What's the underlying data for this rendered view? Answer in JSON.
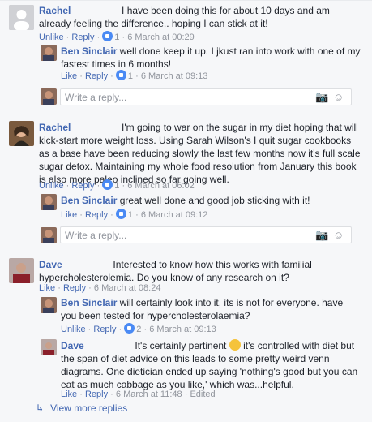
{
  "comments": [
    {
      "author": "Rachel",
      "text": "I have been doing this for about 10 days and am already feeling the difference.. hoping I can stick at it!",
      "action1": "Unlike",
      "action2": "Reply",
      "likes": "1",
      "time": "6 March at 00:29",
      "reply": {
        "author": "Ben Sinclair",
        "text": "well done keep it up. I jkust ran into work with one of my fastest times in 6 months!",
        "action1": "Like",
        "action2": "Reply",
        "likes": "1",
        "time": "6 March at 09:13"
      }
    },
    {
      "author": "Rachel",
      "text": "I'm going to war on the sugar in my diet hoping that will kick-start more weight loss. Using Sarah Wilson's I quit sugar cookbooks as a base have been reducing slowly the last few months now it's full scale sugar detox. Maintaining my whole food resolution from January this book is also more paleo inclined so far going well.",
      "action1": "Unlike",
      "action2": "Reply",
      "likes": "1",
      "time": "6 March at 06:02",
      "reply": {
        "author": "Ben Sinclair",
        "text": "great well done and good job sticking with it!",
        "action1": "Like",
        "action2": "Reply",
        "likes": "1",
        "time": "6 March at 09:12"
      }
    },
    {
      "author": "Dave",
      "text": "Interested to know how this works with familial hypercholesterolemia. Do you know of any research on it?",
      "action1": "Like",
      "action2": "Reply",
      "time": "6 March at 08:24",
      "reply": {
        "author": "Ben Sinclair",
        "text": "will certainly look into it, its is not for everyone. have you been tested for hypercholesterolaemia?",
        "action1": "Unlike",
        "action2": "Reply",
        "likes": "2",
        "time": "6 March at 09:13"
      },
      "reply2": {
        "author": "Dave",
        "text_before": "It's certainly pertinent",
        "text_after": "it's controlled with diet but the span of diet advice on this leads to some pretty weird venn diagrams. One dietician ended up saying 'nothing's good but you can eat as much cabbage as you like,' which was...helpful.",
        "action1": "Like",
        "action2": "Reply",
        "time": "6 March at 11:48",
        "edited": "Edited"
      }
    }
  ],
  "reply_placeholder": "Write a reply...",
  "view_more": "View more replies",
  "separator": "·",
  "icons": {
    "camera": "camera-icon",
    "emoji": "emoji-icon",
    "like": "like-badge-icon",
    "reply-arrow": "reply-arrow-icon"
  },
  "colors": {
    "link": "#4267b2",
    "meta": "#90949c",
    "like": "#4a8af4",
    "background": "#f6f7f9"
  }
}
